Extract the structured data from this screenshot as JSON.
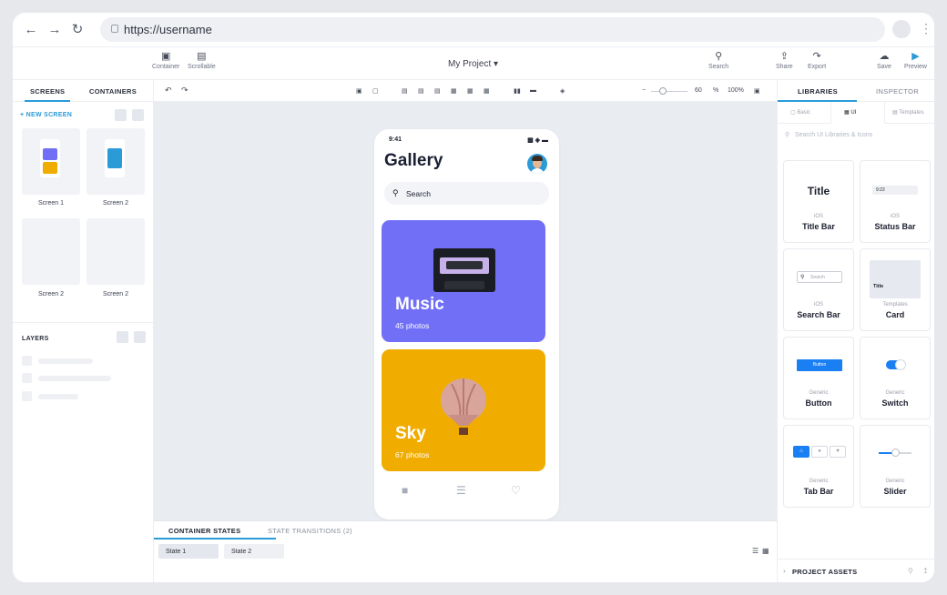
{
  "browser": {
    "url": "https://username"
  },
  "toolbar": {
    "container_label": "Container",
    "scrollable_label": "Scrollable",
    "project_name": "My Project ▾",
    "search_label": "Search",
    "share_label": "Share",
    "export_label": "Export",
    "save_label": "Save",
    "preview_label": "Preview"
  },
  "left_panel": {
    "tabs": [
      "SCREENS",
      "CONTAINERS"
    ],
    "new_screen": "+ NEW SCREEN",
    "screens": [
      "Screen 1",
      "Screen 2",
      "Screen 2",
      "Screen 2"
    ],
    "layers_title": "LAYERS"
  },
  "canvas_toolbar": {
    "zoom_value": "60",
    "zoom_unit": "%",
    "zoom_fit": "100%"
  },
  "phone": {
    "time": "9:41",
    "title": "Gallery",
    "search_placeholder": "Search",
    "cards": [
      {
        "name": "Music",
        "count": "45 photos",
        "color": "#716ff6"
      },
      {
        "name": "Sky",
        "count": "67 photos",
        "color": "#f0ad00"
      }
    ]
  },
  "states": {
    "tabs": [
      "CONTAINER STATES",
      "STATE TRANSITIONS (2)"
    ],
    "chips": [
      "State 1",
      "State 2"
    ]
  },
  "right_panel": {
    "tabs": [
      "LIBRARIES",
      "INSPECTOR"
    ],
    "subtabs": [
      "Basic",
      "UI",
      "Templates"
    ],
    "search_placeholder": "Search UI Libraries & Icons",
    "items": [
      {
        "category": "iOS",
        "name": "Title Bar",
        "preview": "Title"
      },
      {
        "category": "iOS",
        "name": "Status Bar",
        "preview": "9:22"
      },
      {
        "category": "iOS",
        "name": "Search Bar",
        "preview": "Search"
      },
      {
        "category": "Templates",
        "name": "Card",
        "preview": "Title"
      },
      {
        "category": "Generic",
        "name": "Button",
        "preview": "Button"
      },
      {
        "category": "Generic",
        "name": "Switch"
      },
      {
        "category": "Generic",
        "name": "Tab Bar"
      },
      {
        "category": "Generic",
        "name": "Slider"
      }
    ],
    "project_assets": "PROJECT ASSETS"
  },
  "colors": {
    "accent": "#2b9bd8",
    "music": "#716ff6",
    "sky": "#f0ad00"
  }
}
